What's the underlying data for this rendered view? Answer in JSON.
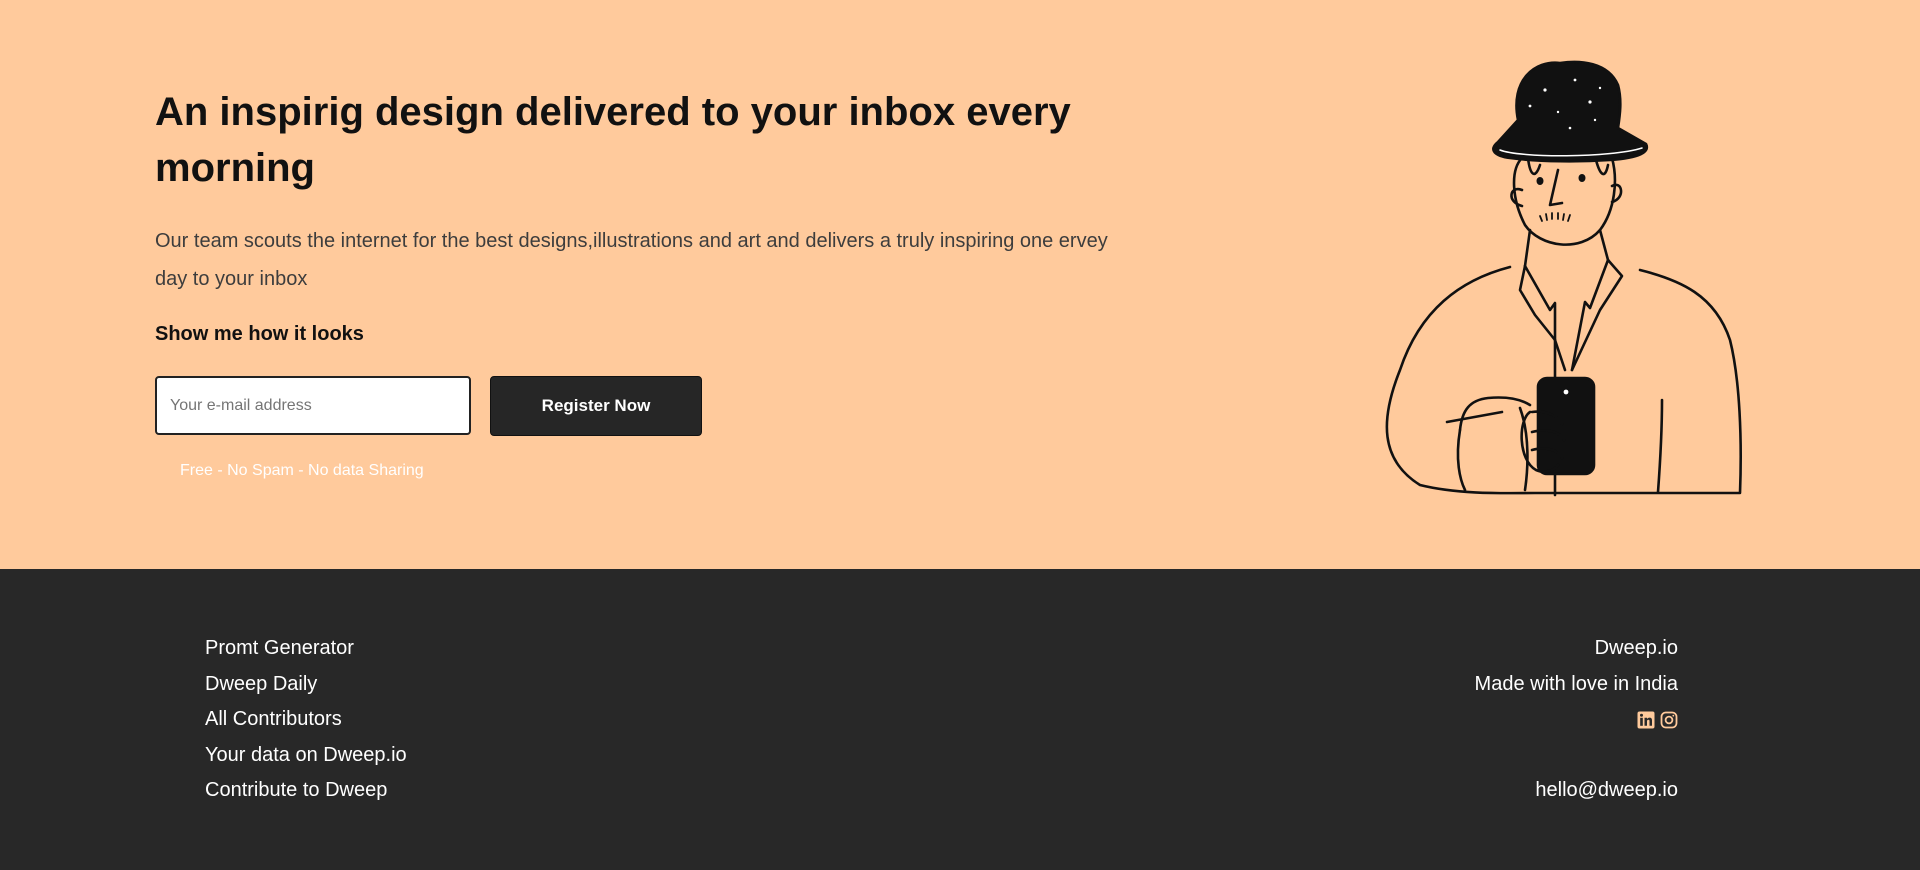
{
  "hero": {
    "title": "An inspirig design delivered to your inbox every morning",
    "description": "Our team scouts the internet for the best designs,illustrations and art and delivers a truly inspiring one ervey day to your inbox",
    "cta_heading": "Show me how it looks",
    "email_placeholder": "Your e-mail address",
    "register_label": "Register Now",
    "disclaimer": "Free - No Spam - No data Sharing"
  },
  "footer": {
    "links": [
      {
        "label": "Promt Generator"
      },
      {
        "label": "Dweep Daily"
      },
      {
        "label": "All Contributors"
      },
      {
        "label": "Your data on Dweep.io"
      },
      {
        "label": "Contribute to Dweep"
      }
    ],
    "brand": "Dweep.io",
    "tagline": "Made with love in India",
    "social_icons": [
      "linkedin-icon",
      "instagram-icon"
    ],
    "email": "hello@dweep.io"
  },
  "colors": {
    "hero_bg": "#ffca9c",
    "footer_bg": "#282828",
    "button_bg": "#262626",
    "social_icon": "#ffca9c"
  }
}
